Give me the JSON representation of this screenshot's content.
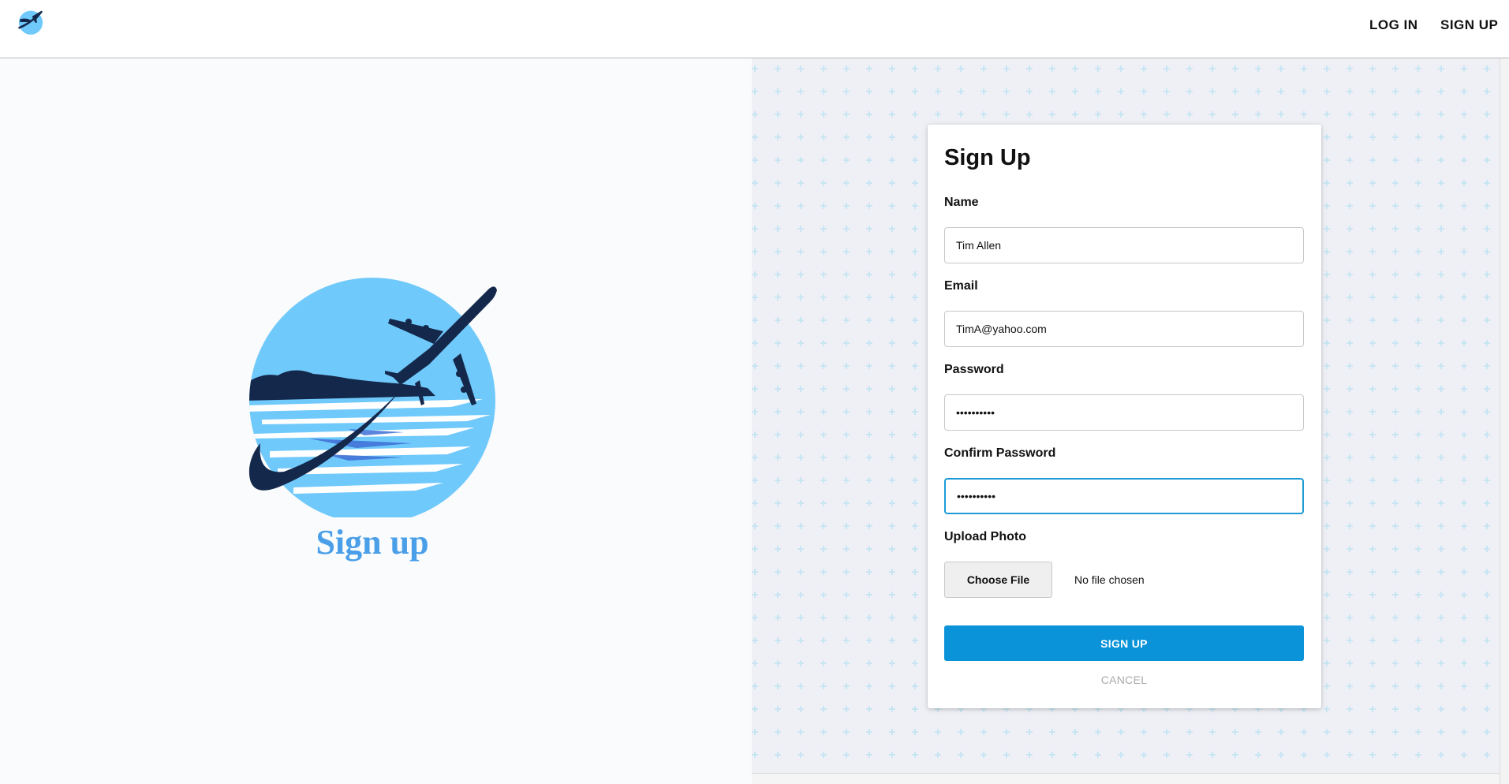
{
  "header": {
    "logo": "airplane-globe-logo-icon",
    "nav": {
      "login_label": "LOG IN",
      "signup_label": "SIGN UP"
    }
  },
  "hero": {
    "logo": "airplane-sunset-logo",
    "title": "Sign up"
  },
  "form": {
    "title": "Sign Up",
    "name": {
      "label": "Name",
      "value": "Tim Allen"
    },
    "email": {
      "label": "Email",
      "value": "TimA@yahoo.com"
    },
    "password": {
      "label": "Password",
      "value": "••••••••••"
    },
    "confirm_password": {
      "label": "Confirm Password",
      "value": "••••••••••"
    },
    "upload": {
      "label": "Upload Photo",
      "button_label": "Choose File",
      "status": "No file chosen"
    },
    "submit_label": "SIGN UP",
    "cancel_label": "CANCEL"
  },
  "colors": {
    "accent": "#0a93d9",
    "hero_title": "#4a9fe8",
    "logo_circle": "#70c9fb",
    "logo_dark": "#14284b",
    "pattern_plus": "#bfe3f2",
    "panel_bg": "#eef0f6"
  }
}
